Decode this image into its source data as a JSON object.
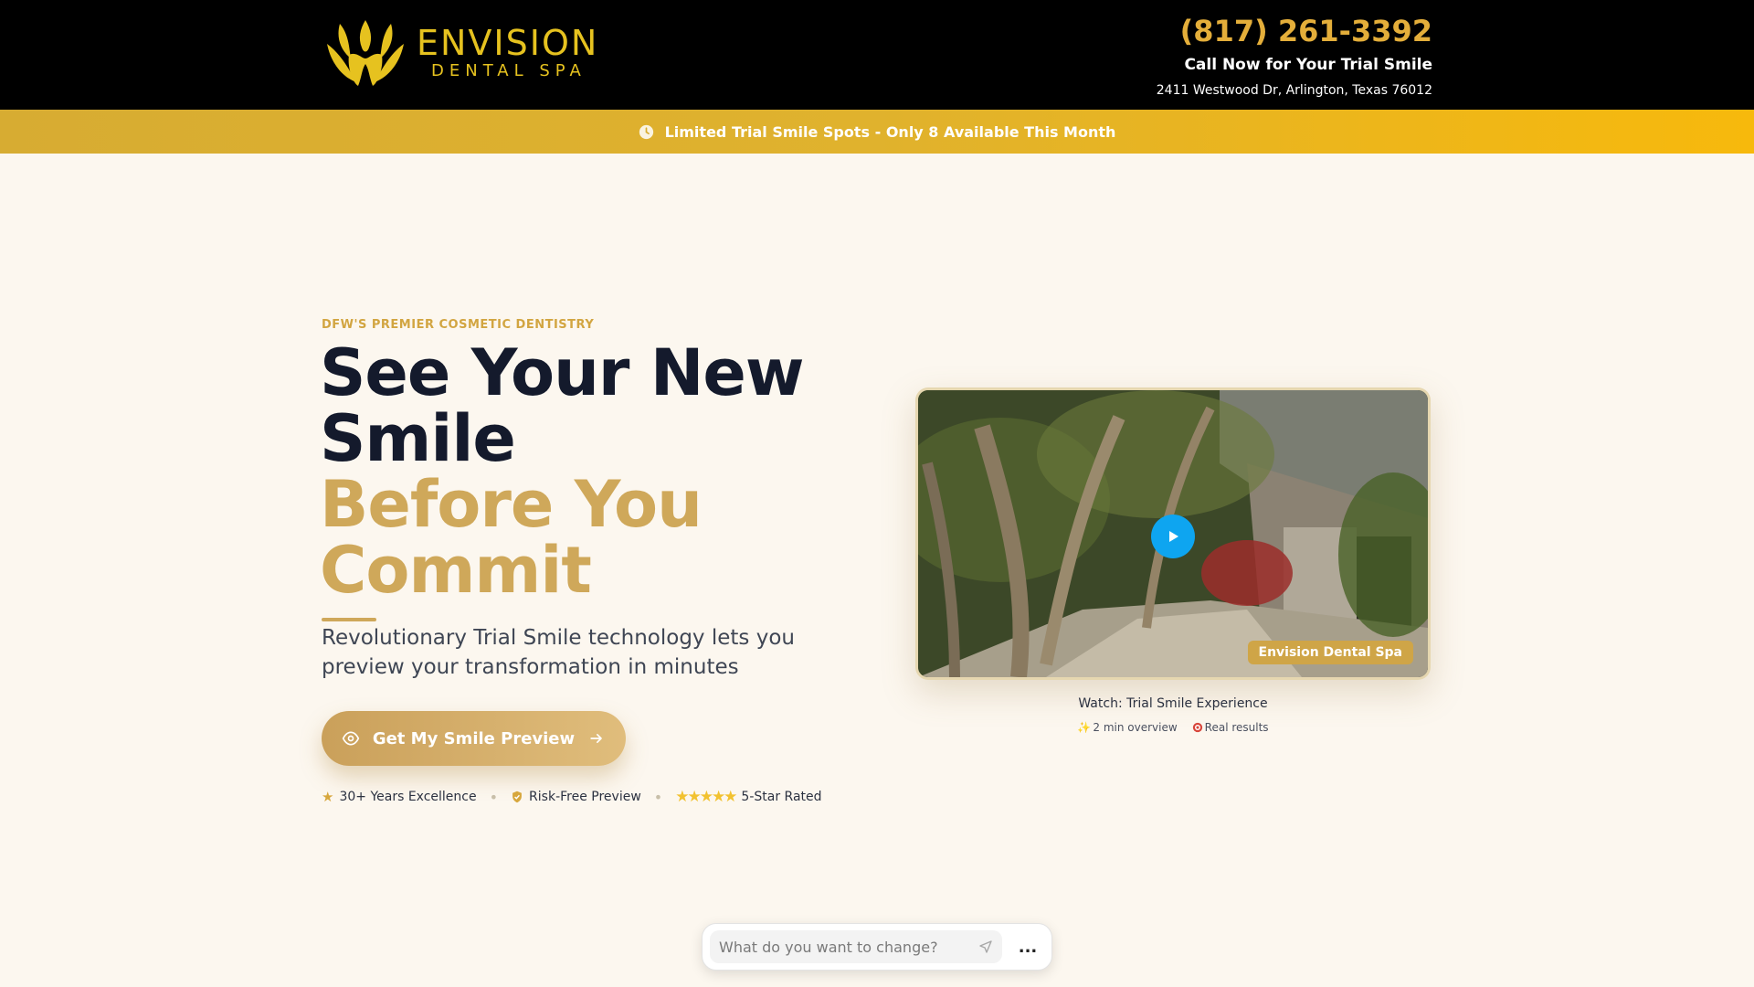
{
  "header": {
    "brand": "ENVISION",
    "brand_sub": "DENTAL SPA",
    "phone": "(817) 261-3392",
    "call_now": "Call Now for Your Trial Smile",
    "address": "2411 Westwood Dr, Arlington, Texas 76012"
  },
  "banner": {
    "text": "Limited Trial Smile Spots - Only 8 Available This Month"
  },
  "hero": {
    "eyebrow": "DFW'S PREMIER COSMETIC DENTISTRY",
    "headline_dark_1": "See Your New",
    "headline_dark_2": "Smile",
    "headline_gold_1": "Before You",
    "headline_gold_2": "Commit",
    "subhead": "Revolutionary Trial Smile technology lets you preview your transformation in minutes",
    "cta_label": "Get My Smile Preview",
    "trust": [
      {
        "icon": "star-icon",
        "label": "30+ Years Excellence"
      },
      {
        "icon": "shield-check-icon",
        "label": "Risk-Free Preview"
      },
      {
        "icon": "stars-icon",
        "label": "5-Star Rated"
      }
    ]
  },
  "video": {
    "badge": "Envision Dental Spa",
    "caption": "Watch: Trial Smile Experience",
    "meta": [
      {
        "icon": "sparkle-icon",
        "label": "2 min overview"
      },
      {
        "icon": "target-icon",
        "label": "Real results"
      }
    ]
  },
  "chatbar": {
    "placeholder": "What do you want to change?",
    "more_label": "..."
  },
  "colors": {
    "gold": "#cfa85a",
    "logo_gold": "#e6c21f",
    "navy": "#141a2c",
    "banner_start": "#d7ac32",
    "banner_end": "#f7b90c",
    "play_blue": "#0ea5f0"
  }
}
